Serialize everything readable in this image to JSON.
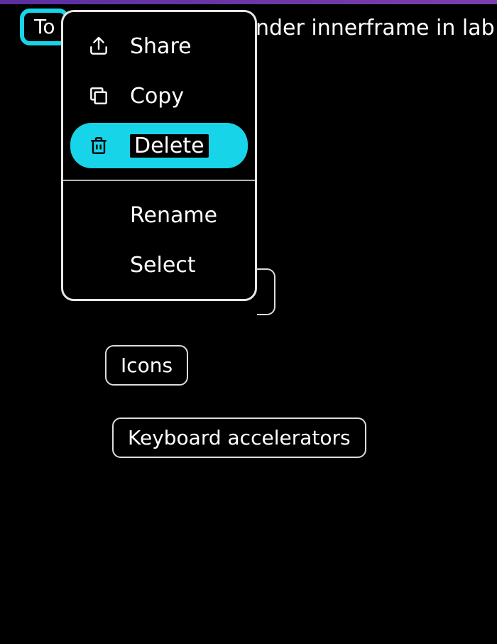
{
  "tab_label": "To",
  "header_partial_text": "nder innerframe in lab",
  "context_menu": {
    "section1": {
      "share": {
        "label": "Share",
        "icon": "share-icon"
      },
      "copy": {
        "label": "Copy",
        "icon": "copy-icon"
      },
      "delete": {
        "label": "Delete",
        "icon": "trash-icon",
        "selected": true
      }
    },
    "section2": {
      "rename": {
        "label": "Rename"
      },
      "select": {
        "label": "Select"
      }
    }
  },
  "chips": {
    "icons": "Icons",
    "keyboard_accelerators": "Keyboard accelerators"
  },
  "colors": {
    "accent": "#17d4e8",
    "bg": "#000000",
    "fg": "#ffffff"
  }
}
